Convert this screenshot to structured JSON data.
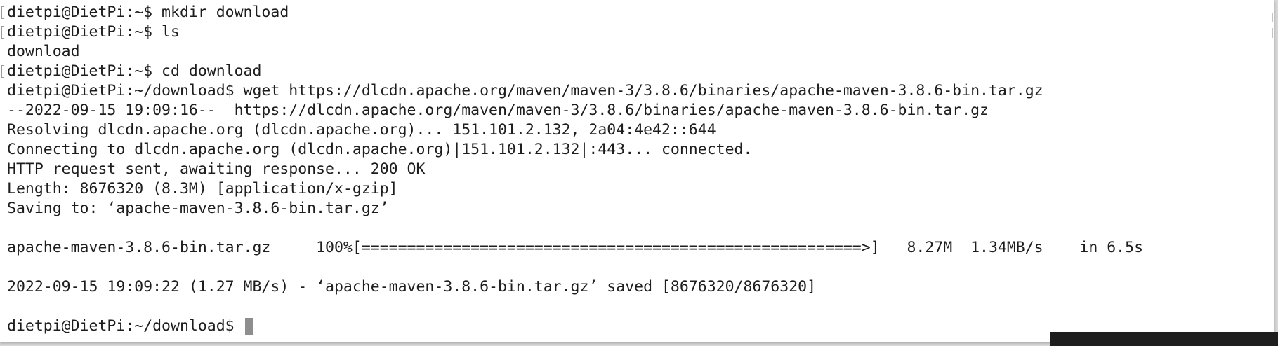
{
  "terminal": {
    "lines": [
      {
        "text": "dietpi@DietPi:~$ mkdir download",
        "mark": true
      },
      {
        "text": "dietpi@DietPi:~$ ls",
        "mark": true
      },
      {
        "text": "download",
        "mark": false
      },
      {
        "text": "dietpi@DietPi:~$ cd download",
        "mark": true
      },
      {
        "text": "dietpi@DietPi:~/download$ wget https://dlcdn.apache.org/maven/maven-3/3.8.6/binaries/apache-maven-3.8.6-bin.tar.gz",
        "mark": false
      },
      {
        "text": "--2022-09-15 19:09:16--  https://dlcdn.apache.org/maven/maven-3/3.8.6/binaries/apache-maven-3.8.6-bin.tar.gz",
        "mark": false
      },
      {
        "text": "Resolving dlcdn.apache.org (dlcdn.apache.org)... 151.101.2.132, 2a04:4e42::644",
        "mark": false
      },
      {
        "text": "Connecting to dlcdn.apache.org (dlcdn.apache.org)|151.101.2.132|:443... connected.",
        "mark": false
      },
      {
        "text": "HTTP request sent, awaiting response... 200 OK",
        "mark": false
      },
      {
        "text": "Length: 8676320 (8.3M) [application/x-gzip]",
        "mark": false
      },
      {
        "text": "Saving to: ‘apache-maven-3.8.6-bin.tar.gz’",
        "mark": false
      },
      {
        "text": "",
        "mark": false
      },
      {
        "text": "apache-maven-3.8.6-bin.tar.gz     100%[=======================================================>]   8.27M  1.34MB/s    in 6.5s",
        "mark": false
      },
      {
        "text": "",
        "mark": false
      },
      {
        "text": "2022-09-15 19:09:22 (1.27 MB/s) - ‘apache-maven-3.8.6-bin.tar.gz’ saved [8676320/8676320]",
        "mark": false
      },
      {
        "text": "",
        "mark": false
      }
    ],
    "prompt": "dietpi@DietPi:~/download$ ",
    "cursor_color": "#8e8e8e",
    "text_color": "#1d1d1d",
    "background_color": "#ffffff"
  },
  "background_window": {
    "text": ""
  }
}
